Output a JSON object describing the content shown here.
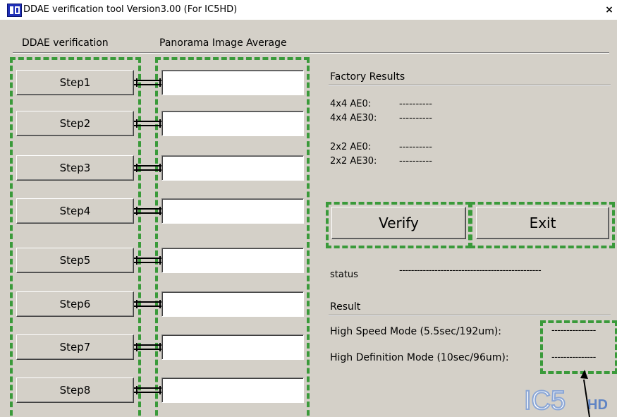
{
  "window": {
    "title": "DDAE verification tool Version3.00 (For IC5HD)",
    "close_label": "×"
  },
  "headers": {
    "left": "DDAE verification",
    "right": "Panorama Image Average"
  },
  "steps": [
    {
      "label": "Step1",
      "value": ""
    },
    {
      "label": "Step2",
      "value": ""
    },
    {
      "label": "Step3",
      "value": ""
    },
    {
      "label": "Step4",
      "value": ""
    },
    {
      "label": "Step5",
      "value": ""
    },
    {
      "label": "Step6",
      "value": ""
    },
    {
      "label": "Step7",
      "value": ""
    },
    {
      "label": "Step8",
      "value": ""
    }
  ],
  "factory": {
    "title": "Factory Results",
    "rows": [
      {
        "label": "4x4 AE0:",
        "value": "----------"
      },
      {
        "label": "4x4 AE30:",
        "value": "----------"
      },
      {
        "label": "2x2 AE0:",
        "value": "----------"
      },
      {
        "label": "2x2 AE30:",
        "value": "----------"
      }
    ]
  },
  "buttons": {
    "verify": "Verify",
    "exit": "Exit"
  },
  "status": {
    "label": "status",
    "value": "------------------------------------------------"
  },
  "result": {
    "title": "Result",
    "high_speed_label": "High Speed Mode  (5.5sec/192um):",
    "high_speed_value": "---------------",
    "high_def_label": "High Definition Mode (10sec/96um):",
    "high_def_value": "---------------"
  },
  "logo": {
    "text_main": "IC5",
    "text_sub": "HD",
    "color": "#8aa6d6"
  },
  "colors": {
    "window_bg": "#d4d0c8",
    "highlight_dash": "#3a9a3a"
  }
}
